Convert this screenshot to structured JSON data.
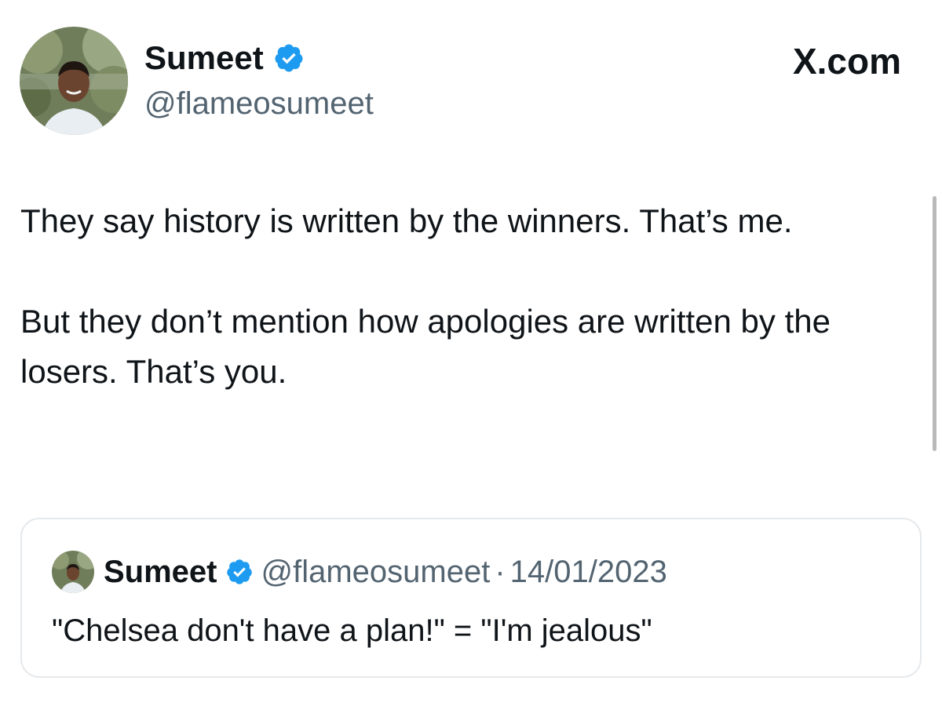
{
  "brand": {
    "label": "X.com"
  },
  "author": {
    "name": "Sumeet",
    "handle": "@flameosumeet",
    "verified": true,
    "verified_icon": "verified-badge-icon",
    "verified_color": "#1d9bf0"
  },
  "tweet": {
    "paragraphs": [
      "They say history is written by the winners. That’s me.",
      "But they don’t mention how apologies are written by the losers. That’s you."
    ]
  },
  "quoted_tweet": {
    "name": "Sumeet",
    "handle": "@flameosumeet",
    "separator": "·",
    "date": "14/01/2023",
    "text": "\"Chelsea don't have a plan!\" = \"I'm jealous\""
  },
  "colors": {
    "text_primary": "#0f1419",
    "text_secondary": "#536471",
    "border": "#e6e9ec",
    "accent": "#1d9bf0"
  }
}
